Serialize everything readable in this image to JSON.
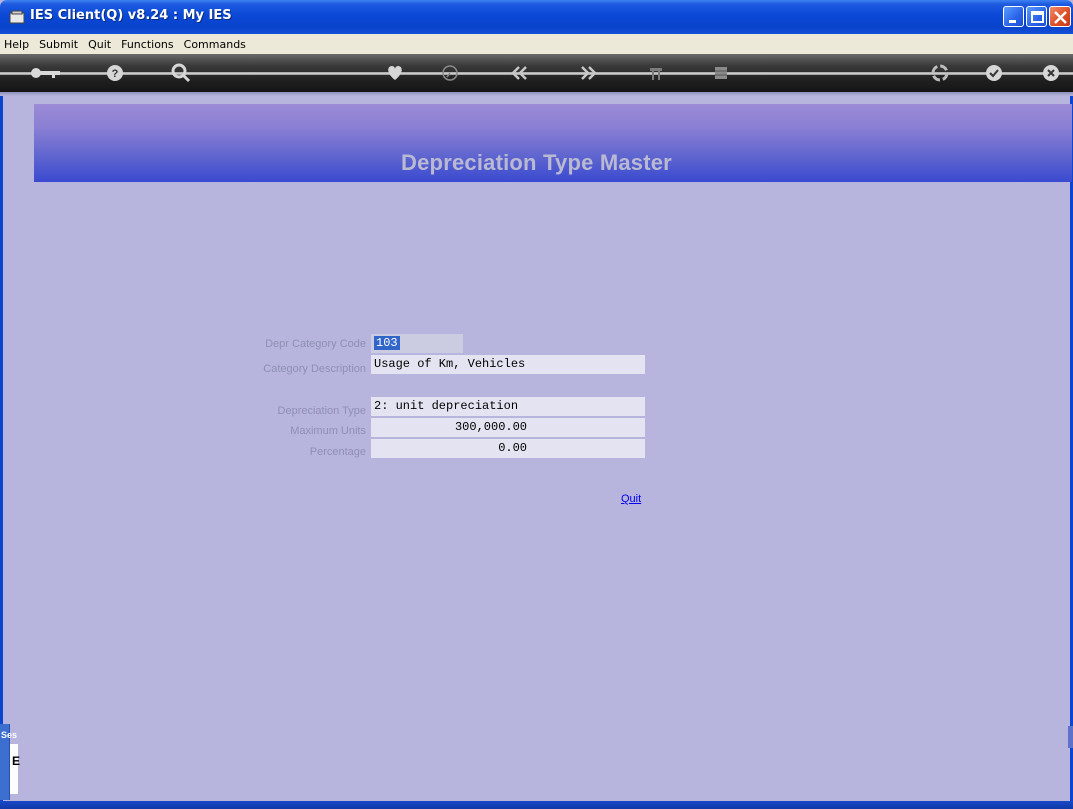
{
  "window": {
    "title": "IES Client(Q) v8.24 : My IES"
  },
  "menu": {
    "items": [
      "Help",
      "Submit",
      "Quit",
      "Functions",
      "Commands"
    ]
  },
  "toolbar": {
    "icons": [
      "key-icon",
      "help-icon",
      "search-icon",
      "heart-icon",
      "clock-icon",
      "rewind-icon",
      "forward-icon",
      "tools-icon",
      "grid-icon",
      "recycle-icon",
      "check-icon",
      "close-icon"
    ]
  },
  "banner": {
    "title": "Depreciation Type Master"
  },
  "form": {
    "code_label": "Depr Category Code",
    "code_value": "103",
    "description_label": "Category Description",
    "description_value": "Usage of Km, Vehicles",
    "type_label": "Depreciation Type",
    "type_value": "2: unit depreciation",
    "max_units_label": "Maximum Units",
    "max_units_value": "300,000.00",
    "percentage_label": "Percentage",
    "percentage_value": "0.00"
  },
  "actions": {
    "quit_label": "Quit"
  },
  "session": {
    "label": "Ses",
    "glyph": "E"
  },
  "colors": {
    "background": "#b7b5de",
    "titlebar": "#0a48d6",
    "banner_start": "#9c8bd6",
    "banner_end": "#3a4ad0",
    "link": "#0000ee"
  }
}
